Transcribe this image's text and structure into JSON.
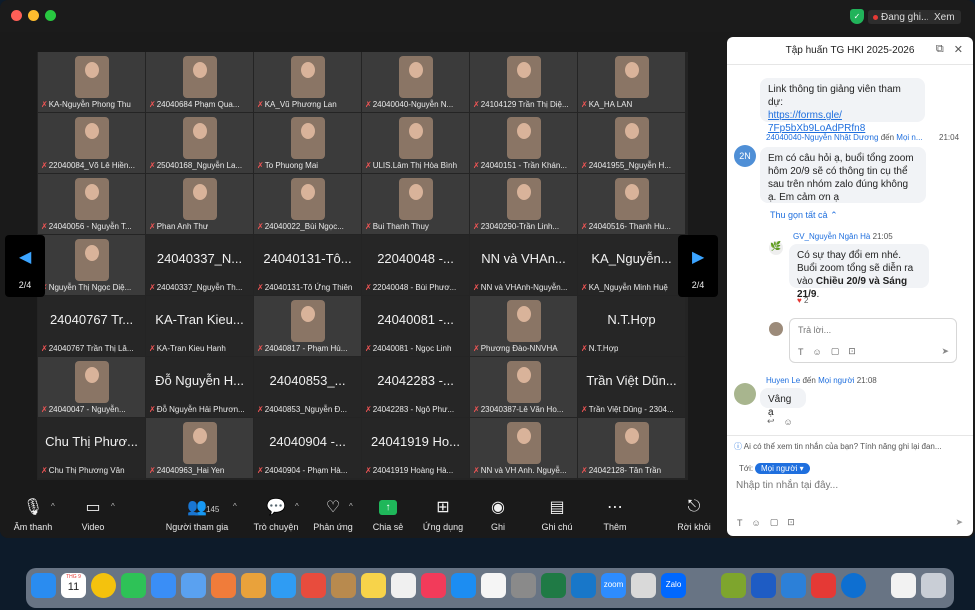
{
  "window": {
    "title_rec": "Đang ghi...",
    "view": "Xem"
  },
  "tiles": [
    {
      "r": 0,
      "c": 0,
      "video": true,
      "label": "KA-Nguyễn Phong Thu"
    },
    {
      "r": 0,
      "c": 1,
      "video": true,
      "label": "24040684 Phạm Qua..."
    },
    {
      "r": 0,
      "c": 2,
      "video": true,
      "label": "KA_Vũ Phương Lan"
    },
    {
      "r": 0,
      "c": 3,
      "video": true,
      "label": "24040040-Nguyễn N..."
    },
    {
      "r": 0,
      "c": 4,
      "video": true,
      "label": "24104129 Trần Thị Diệ..."
    },
    {
      "r": 0,
      "c": 5,
      "video": true,
      "label": "KA_HA LAN"
    },
    {
      "r": 1,
      "c": 0,
      "video": true,
      "label": "22040084_Võ Lê Hiền..."
    },
    {
      "r": 1,
      "c": 1,
      "video": true,
      "label": "25040168_Nguyễn La..."
    },
    {
      "r": 1,
      "c": 2,
      "video": true,
      "label": "To Phuong Mai"
    },
    {
      "r": 1,
      "c": 3,
      "video": true,
      "label": "ULIS.Lâm Thị Hòa Bình"
    },
    {
      "r": 1,
      "c": 4,
      "video": true,
      "label": "24040151 - Trần Khán..."
    },
    {
      "r": 1,
      "c": 5,
      "video": true,
      "label": "24041955_Nguyễn H..."
    },
    {
      "r": 2,
      "c": 0,
      "video": true,
      "label": "24040056 - Nguyễn T..."
    },
    {
      "r": 2,
      "c": 1,
      "video": true,
      "label": "Phan Anh Thư"
    },
    {
      "r": 2,
      "c": 2,
      "video": true,
      "label": "24040022_Bùi Ngọc..."
    },
    {
      "r": 2,
      "c": 3,
      "video": true,
      "label": "Bui Thanh Thuy"
    },
    {
      "r": 2,
      "c": 4,
      "video": true,
      "label": "23040290-Trần Linh..."
    },
    {
      "r": 2,
      "c": 5,
      "video": true,
      "label": "24040516- Thanh Hu..."
    },
    {
      "r": 3,
      "c": 0,
      "video": true,
      "label": "Nguyễn Thị Ngọc Diệ..."
    },
    {
      "r": 3,
      "c": 1,
      "video": false,
      "big": "24040337_N...",
      "label": "24040337_Nguyễn Th..."
    },
    {
      "r": 3,
      "c": 2,
      "video": false,
      "big": "24040131-Tô...",
      "label": "24040131-Tô Ứng Thiên"
    },
    {
      "r": 3,
      "c": 3,
      "video": false,
      "big": "22040048 -...",
      "label": "22040048 - Bùi Phươ..."
    },
    {
      "r": 3,
      "c": 4,
      "video": false,
      "big": "NN và VHAn...",
      "label": "NN và VHAnh-Nguyễn..."
    },
    {
      "r": 3,
      "c": 5,
      "video": false,
      "big": "KA_Nguyễn...",
      "label": "KA_Nguyễn Minh Huệ"
    },
    {
      "r": 4,
      "c": 0,
      "video": false,
      "big": "24040767 Tr...",
      "label": "24040767 Trần Thị Lâ..."
    },
    {
      "r": 4,
      "c": 1,
      "video": false,
      "big": "KA-Tran Kieu...",
      "label": "KA-Tran Kieu Hanh"
    },
    {
      "r": 4,
      "c": 2,
      "video": true,
      "label": "24040817 - Phạm Hù..."
    },
    {
      "r": 4,
      "c": 3,
      "video": false,
      "big": "24040081 -...",
      "label": "24040081 - Ngọc Linh"
    },
    {
      "r": 4,
      "c": 4,
      "video": true,
      "label": "Phương Đào-NNVHA"
    },
    {
      "r": 4,
      "c": 5,
      "video": false,
      "big": "N.T.Hợp",
      "label": "N.T.Hợp"
    },
    {
      "r": 5,
      "c": 0,
      "video": true,
      "label": "24040047 - Nguyễn..."
    },
    {
      "r": 5,
      "c": 1,
      "video": false,
      "big": "Đỗ Nguyễn H...",
      "label": "Đỗ Nguyễn Hải Phươn..."
    },
    {
      "r": 5,
      "c": 2,
      "video": false,
      "big": "24040853_...",
      "label": "24040853_Nguyễn Đ..."
    },
    {
      "r": 5,
      "c": 3,
      "video": false,
      "big": "24042283 -...",
      "label": "24042283 - Ngô Phư..."
    },
    {
      "r": 5,
      "c": 4,
      "video": true,
      "label": "23040387-Lê Văn Ho..."
    },
    {
      "r": 5,
      "c": 5,
      "video": false,
      "big": "Trần Việt Dũn...",
      "label": "Trần Việt Dũng - 2304..."
    },
    {
      "r": 6,
      "c": 0,
      "video": false,
      "big": "Chu Thị Phươ...",
      "label": "Chu Thị Phương Vân"
    },
    {
      "r": 6,
      "c": 1,
      "video": true,
      "label": "24040963_Hai Yen"
    },
    {
      "r": 6,
      "c": 2,
      "video": false,
      "big": "24040904 -...",
      "label": "24040904 - Phạm Hà..."
    },
    {
      "r": 6,
      "c": 3,
      "video": false,
      "big": "24041919 Ho...",
      "label": "24041919 Hoàng Hà..."
    },
    {
      "r": 6,
      "c": 4,
      "video": true,
      "label": "NN và VH Anh. Nguyễ..."
    },
    {
      "r": 6,
      "c": 5,
      "video": true,
      "label": "24042128- Tân Trần"
    }
  ],
  "nav": {
    "left_page": "2/4",
    "right_page": "2/4"
  },
  "toolbar": {
    "audio": "Âm thanh",
    "video": "Video",
    "participants": "Người tham gia",
    "participants_count": "145",
    "chat": "Trò chuyện",
    "react": "Phản ứng",
    "share": "Chia sẻ",
    "apps": "Ứng dụng",
    "record": "Ghi",
    "notes": "Ghi chú",
    "more": "Thêm",
    "leave": "Rời khỏi"
  },
  "chat": {
    "title": "Tập huấn TG HKI 2025-2026",
    "m1_text": "Link thông tin giảng viên tham dự:",
    "m1_link": "https://forms.gle/\n7Fp5bXb9LoAdPRfn8",
    "m2_sender": "24040040-Nguyễn Nhật Dương",
    "m2_to": "đến",
    "m2_recipient": "Mọi n...",
    "m2_time": "21:04",
    "m2_avatar": "2N",
    "m2_text": "Em có câu hỏi ạ, buổi tổng zoom hôm 20/9 sẽ có thông tin cụ thể sau trên nhóm zalo đúng không ạ. Em cảm ơn ạ",
    "collapse": "Thu gọn tất cả",
    "r_sender": "GV_Nguyễn Ngân Hà",
    "r_time": "21:05",
    "r_text1": "Có sự thay đổi em nhé. Buổi zoom tổng sẽ diễn ra vào ",
    "r_bold": "Chiều 20/9 và Sáng 21/9",
    "r_text2": ".",
    "r_reaction": "2",
    "reply_placeholder": "Trả lời...",
    "m3_sender": "Huyen Le",
    "m3_to": "đến",
    "m3_recipient": "Mọi người",
    "m3_time": "21:08",
    "m3_text": "Vâng ạ",
    "notice": "Ai có thể xem tin nhắn của bạn? Tính năng ghi lại đan...",
    "to_label": "Tới:",
    "to_value": "Mọi người",
    "compose_placeholder": "Nhập tin nhắn tại đây..."
  },
  "dock": {
    "calendar_month": "THG 9",
    "calendar_day": "11",
    "zalo": "Zalo",
    "zoom": "zoom"
  }
}
